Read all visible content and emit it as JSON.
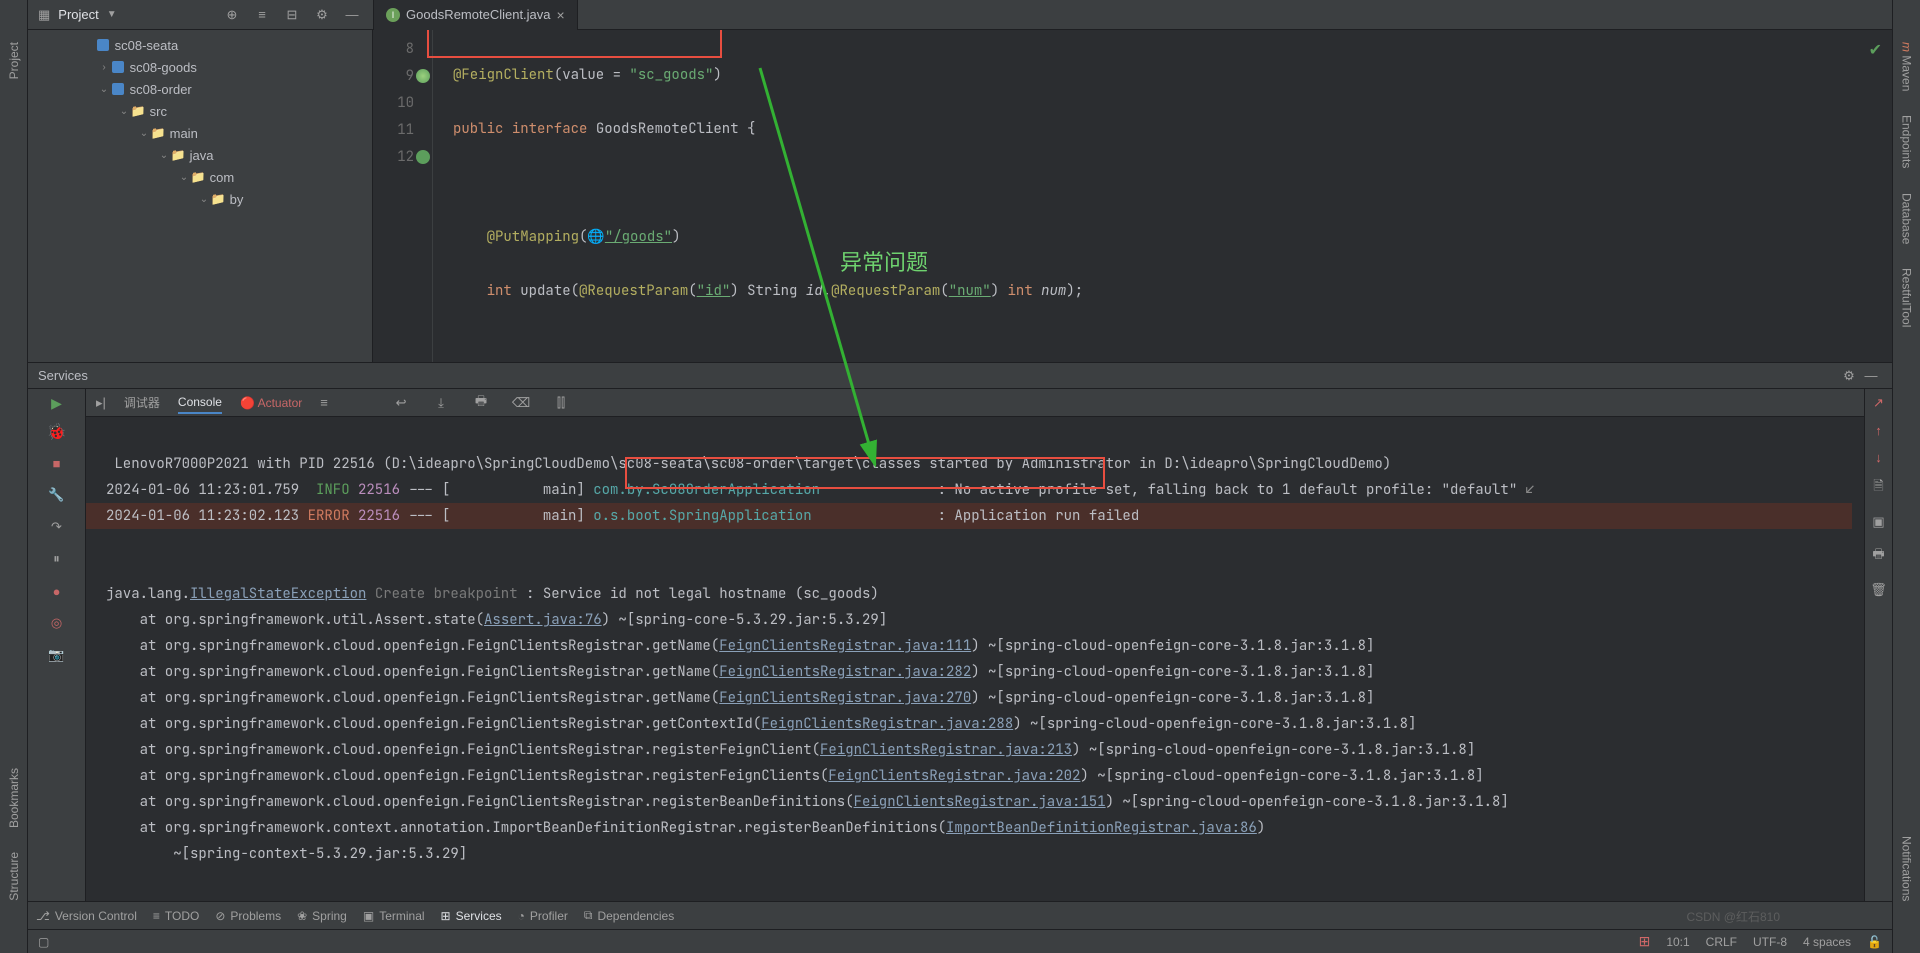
{
  "topbar": {
    "project_label": "Project"
  },
  "editor_tab": {
    "filename": "GoodsRemoteClient.java"
  },
  "tree": {
    "n0": "sc08-seata",
    "n1": "sc08-goods",
    "n2": "sc08-order",
    "n3": "src",
    "n4": "main",
    "n5": "java",
    "n6": "com",
    "n7": "by"
  },
  "gutter": {
    "l8": "8",
    "l9": "9",
    "l10": "10",
    "l11": "11",
    "l12": "12"
  },
  "code": {
    "l8_ann": "@FeignClient",
    "l8_rest": "(value = ",
    "l8_str": "\"sc_goods\"",
    "l8_end": ")",
    "l9_pub": "public ",
    "l9_int": "interface ",
    "l9_cls": "GoodsRemoteClient ",
    "l9_brace": "{",
    "l11_ann": "@PutMapping",
    "l11_open": "(",
    "l11_str": "\"/goods\"",
    "l11_close": ")",
    "l12_kw_int": "int ",
    "l12_method": "update(",
    "l12_rp1": "@RequestParam",
    "l12_p1open": "(",
    "l12_p1str": "\"id\"",
    "l12_p1close": ") ",
    "l12_t1": "String ",
    "l12_v1": "id",
    "l12_comma": ",",
    "l12_rp2": "@RequestParam",
    "l12_p2open": "(",
    "l12_p2str": "\"num\"",
    "l12_p2close": ") ",
    "l12_t2": "int ",
    "l12_v2": "num",
    "l12_end": ");"
  },
  "services": {
    "title": "Services",
    "tab_debug": "调试器",
    "tab_console": "Console",
    "tab_actuator": "Actuator"
  },
  "console": {
    "line0": " LenovoR7000P2021 with PID 22516 (D:\\ideapro\\SpringCloudDemo\\sc08-seata\\sc08-order\\target\\classes started by Administrator in D:\\ideapro\\SpringCloudDemo)",
    "line1_ts": "2024-01-06 11:23:01.759  ",
    "line1_lvl": "INFO",
    "line1_pid": " 22516",
    "line1_mid": " --- [           main] ",
    "line1_logger": "com.by.Sc08OrderApplication",
    "line1_msg": "              : No active profile set, falling back to 1 default profile: \"default\"",
    "line2_ts": "2024-01-06 11:23:02.123 ",
    "line2_lvl": "ERROR",
    "line2_pid": " 22516",
    "line2_mid": " --- [           main] ",
    "line2_logger": "o.s.boot.SpringApplication",
    "line2_msg": "               : Application run failed",
    "ex_pkg": "java.lang.",
    "ex_cls": "IllegalStateException",
    "ex_bp": "Create breakpoint",
    "ex_msg": " : Service id not legal hostname (sc_goods)",
    "st1_pre": "    at org.springframework.util.Assert.state(",
    "st1_link": "Assert.java:76",
    "st1_post": ") ~[spring-core-5.3.29.jar:5.3.29]",
    "st2_pre": "    at org.springframework.cloud.openfeign.FeignClientsRegistrar.getName(",
    "st2_link": "FeignClientsRegistrar.java:111",
    "st2_post": ") ~[spring-cloud-openfeign-core-3.1.8.jar:3.1.8]",
    "st3_pre": "    at org.springframework.cloud.openfeign.FeignClientsRegistrar.getName(",
    "st3_link": "FeignClientsRegistrar.java:282",
    "st3_post": ") ~[spring-cloud-openfeign-core-3.1.8.jar:3.1.8]",
    "st4_pre": "    at org.springframework.cloud.openfeign.FeignClientsRegistrar.getName(",
    "st4_link": "FeignClientsRegistrar.java:270",
    "st4_post": ") ~[spring-cloud-openfeign-core-3.1.8.jar:3.1.8]",
    "st5_pre": "    at org.springframework.cloud.openfeign.FeignClientsRegistrar.getContextId(",
    "st5_link": "FeignClientsRegistrar.java:288",
    "st5_post": ") ~[spring-cloud-openfeign-core-3.1.8.jar:3.1.8]",
    "st6_pre": "    at org.springframework.cloud.openfeign.FeignClientsRegistrar.registerFeignClient(",
    "st6_link": "FeignClientsRegistrar.java:213",
    "st6_post": ") ~[spring-cloud-openfeign-core-3.1.8.jar:3.1.8]",
    "st7_pre": "    at org.springframework.cloud.openfeign.FeignClientsRegistrar.registerFeignClients(",
    "st7_link": "FeignClientsRegistrar.java:202",
    "st7_post": ") ~[spring-cloud-openfeign-core-3.1.8.jar:3.1.8]",
    "st8_pre": "    at org.springframework.cloud.openfeign.FeignClientsRegistrar.registerBeanDefinitions(",
    "st8_link": "FeignClientsRegistrar.java:151",
    "st8_post": ") ~[spring-cloud-openfeign-core-3.1.8.jar:3.1.8]",
    "st9_pre": "    at org.springframework.context.annotation.ImportBeanDefinitionRegistrar.registerBeanDefinitions(",
    "st9_link": "ImportBeanDefinitionRegistrar.java:86",
    "st9_post": ")",
    "st10": "        ~[spring-context-5.3.29.jar:5.3.29]"
  },
  "bottom_tabs": {
    "vc": "Version Control",
    "todo": "TODO",
    "problems": "Problems",
    "spring": "Spring",
    "terminal": "Terminal",
    "services": "Services",
    "profiler": "Profiler",
    "deps": "Dependencies"
  },
  "status": {
    "pos": "10:1",
    "crlf": "CRLF",
    "enc": "UTF-8",
    "indent": "4 spaces"
  },
  "right_tabs": {
    "maven": "Maven",
    "endpoints": "Endpoints",
    "database": "Database",
    "restful": "RestfulTool",
    "notifications": "Notifications"
  },
  "left_tabs": {
    "project": "Project",
    "bookmarks": "Bookmarks",
    "structure": "Structure"
  },
  "annotation": {
    "label": "异常问题"
  },
  "watermark": "CSDN @红石810"
}
